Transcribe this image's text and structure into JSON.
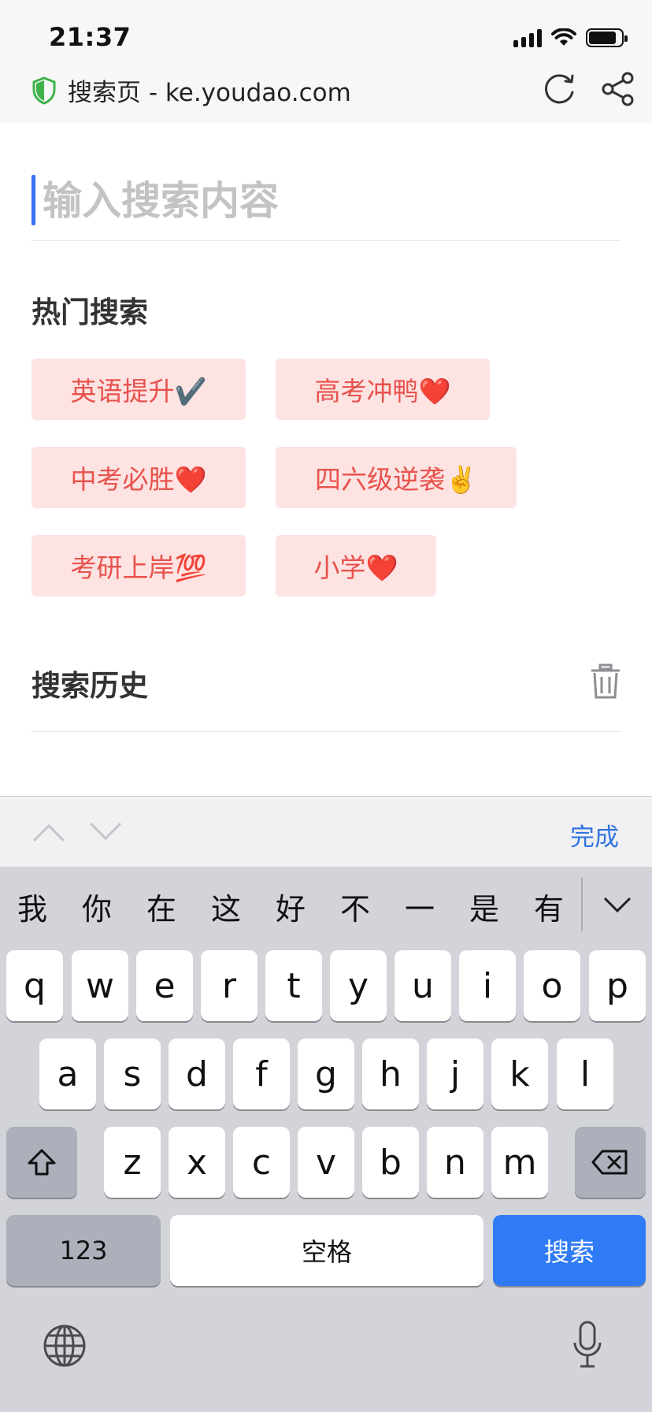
{
  "status_bar": {
    "time": "21:37"
  },
  "address_bar": {
    "title": "搜索页 - ke.youdao.com"
  },
  "search": {
    "placeholder": "输入搜索内容",
    "value": ""
  },
  "hot_search": {
    "title": "热门搜索",
    "items": [
      "英语提升✔️",
      "高考冲鸭❤️",
      "中考必胜❤️",
      "四六级逆袭✌️",
      "考研上岸💯",
      "小学❤️"
    ]
  },
  "history": {
    "title": "搜索历史"
  },
  "accessory": {
    "done_label": "完成"
  },
  "keyboard": {
    "candidates": [
      "我",
      "你",
      "在",
      "这",
      "好",
      "不",
      "一",
      "是",
      "有"
    ],
    "row1": [
      "q",
      "w",
      "e",
      "r",
      "t",
      "y",
      "u",
      "i",
      "o",
      "p"
    ],
    "row2": [
      "a",
      "s",
      "d",
      "f",
      "g",
      "h",
      "j",
      "k",
      "l"
    ],
    "row3": [
      "z",
      "x",
      "c",
      "v",
      "b",
      "n",
      "m"
    ],
    "numbers_label": "123",
    "space_label": "空格",
    "search_label": "搜索"
  },
  "colors": {
    "accent": "#2f7bf5",
    "chip_bg": "#fde3e2",
    "chip_text": "#e8524d",
    "caret": "#3a6ef5"
  },
  "icons": [
    "shield-icon",
    "reload-icon",
    "share-icon",
    "trash-icon",
    "chevron-up-icon",
    "chevron-down-icon",
    "shift-icon",
    "backspace-icon",
    "globe-icon",
    "microphone-icon"
  ]
}
